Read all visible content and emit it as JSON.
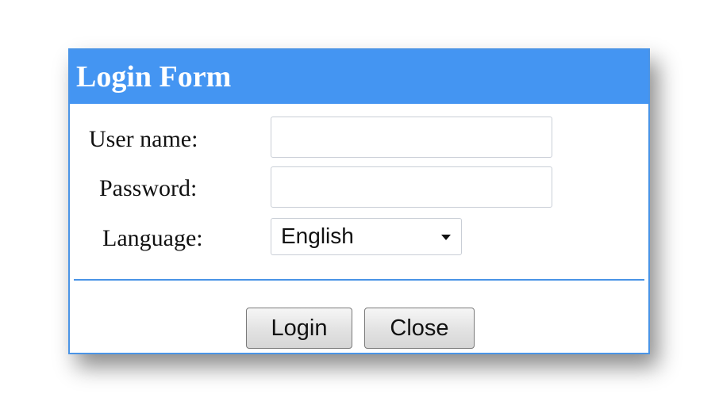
{
  "dialog": {
    "title": "Login Form"
  },
  "form": {
    "username_label": "User name:",
    "username_value": "",
    "password_label": "Password:",
    "password_value": "",
    "language_label": "Language:",
    "language_selected": "English"
  },
  "buttons": {
    "login_label": "Login",
    "close_label": "Close"
  },
  "colors": {
    "title_bar": "#4495f2",
    "border": "#4a94e6"
  }
}
